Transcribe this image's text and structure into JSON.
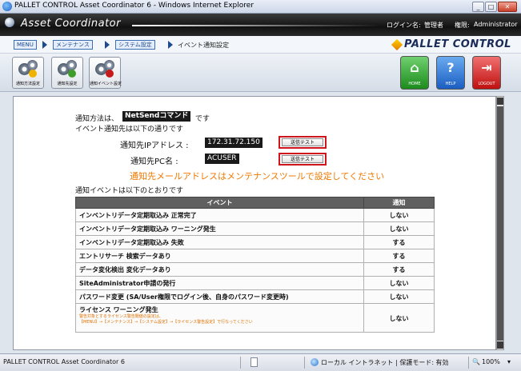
{
  "window": {
    "title": "PALLET CONTROL Asset Coordinator 6 - Windows Internet Explorer"
  },
  "header": {
    "app_name": "Asset Coordinator",
    "login_label": "ログイン名:",
    "login_value": "管理者",
    "role_label": "権限:",
    "role_value": "Administrator"
  },
  "breadcrumb": {
    "items": [
      "MENU",
      "メンテナンス",
      "システム設定"
    ],
    "current": "イベント通知設定",
    "brand": "PALLET CONTROL"
  },
  "toolbar": {
    "tools": [
      {
        "label": "通知方法設定"
      },
      {
        "label": "通知先設定"
      },
      {
        "label": "通知イベント設定"
      }
    ],
    "home_label": "HOME",
    "help_label": "HELP",
    "logout_label": "LOGOUT",
    "colors": {
      "home": "#2ea52e",
      "help": "#1f6fd1",
      "logout": "#d81b1b"
    }
  },
  "notify": {
    "method_prefix": "通知方法は、",
    "method_value": "NetSendコマンド",
    "method_suffix": "です",
    "dest_intro": "イベント通知先は以下の通りです",
    "ip_label": "通知先IPアドレス :",
    "ip_value": "172.31.72.150",
    "pc_label": "通知先PC名 :",
    "pc_value": "ACUSER",
    "test_button": "送信テスト",
    "mail_warning": "通知先メールアドレスはメンテナンスツールで設定してください",
    "events_intro": "通知イベントは以下のとおりです"
  },
  "events": {
    "headers": [
      "イベント",
      "通知"
    ],
    "rows": [
      {
        "event": "インベントリデータ定期取込み 正常完了",
        "notify": "しない"
      },
      {
        "event": "インベントリデータ定期取込み ワーニング発生",
        "notify": "しない"
      },
      {
        "event": "インベントリデータ定期取込み 失敗",
        "notify": "する"
      },
      {
        "event": "エントリサーチ 検索データあり",
        "notify": "する"
      },
      {
        "event": "データ変化検出 変化データあり",
        "notify": "する"
      },
      {
        "event": "SiteAdministrator申請の発行",
        "notify": "しない"
      },
      {
        "event": "パスワード変更 (SA/User権限でログイン後、自身のパスワード変更時)",
        "notify": "しない"
      },
      {
        "event": "ライセンス ワーニング発生",
        "notify": "しない",
        "note1": "警告対象とするライセンス警告閾値の設定は、",
        "note2": "【MENU】→【メンテナンス】→【システム設定】→【ライセンス警告設定】で行なってください"
      }
    ]
  },
  "statusbar": {
    "left": "PALLET CONTROL Asset Coordinator 6",
    "zone": "ローカル イントラネット | 保護モード: 有効",
    "zoom": "100%"
  }
}
